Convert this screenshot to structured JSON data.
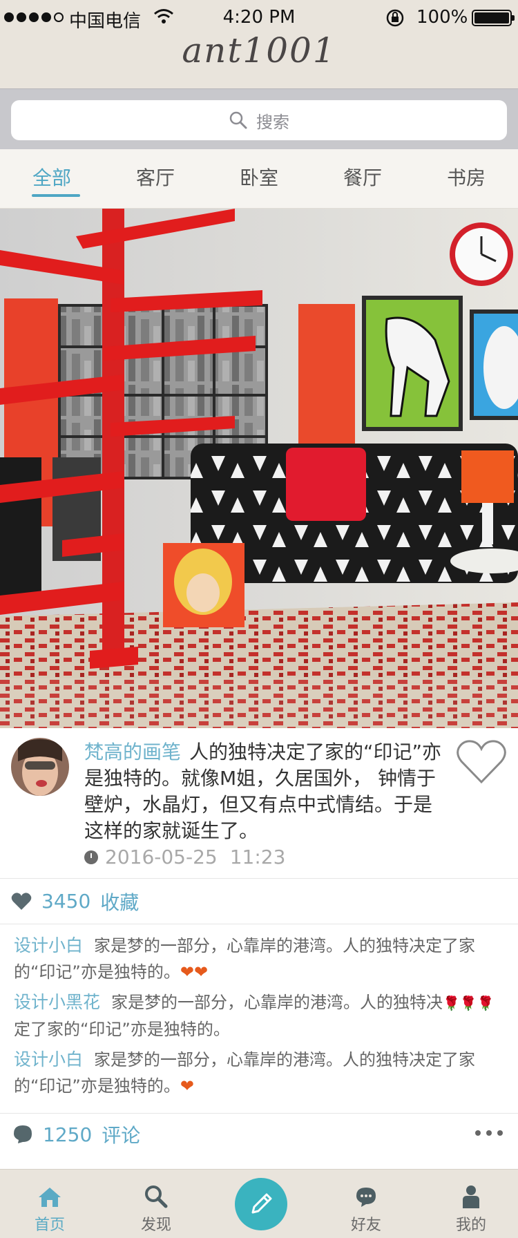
{
  "status_bar": {
    "carrier": "中国电信",
    "time": "4:20 PM",
    "battery": "100%"
  },
  "header": {
    "logo": "ant1001"
  },
  "search": {
    "placeholder": "搜索"
  },
  "tabs": [
    {
      "label": "全部",
      "active": true
    },
    {
      "label": "客厅",
      "active": false
    },
    {
      "label": "卧室",
      "active": false
    },
    {
      "label": "餐厅",
      "active": false
    },
    {
      "label": "书房",
      "active": false
    }
  ],
  "post": {
    "author": "梵高的画笔",
    "text": "人的独特决定了家的“印记”亦是独特的。就像M姐，久居国外， 钟情于壁炉，水晶灯，但又有点中式情结。于是这样的家就诞生了。",
    "date": "2016-05-25",
    "time": "11:23"
  },
  "favorites": {
    "count": "3450",
    "label": "收藏"
  },
  "comments": [
    {
      "author": "设计小白",
      "text": "家是梦的一部分，心靠岸的港湾。人的独特决定了家的“印记”亦是独特的。",
      "emoji": "❤❤"
    },
    {
      "author": "设计小黑花",
      "text": "家是梦的一部分，心靠岸的港湾。人的独特决",
      "emoji": "🌹🌹🌹",
      "text2": "定了家的“印记”亦是独特的。"
    },
    {
      "author": "设计小白",
      "text": "家是梦的一部分，心靠岸的港湾。人的独特决定了家的“印记”亦是独特的。",
      "emoji": "❤"
    }
  ],
  "comment_summary": {
    "count": "1250",
    "label": "评论"
  },
  "bottom_nav": [
    {
      "label": "首页",
      "icon": "home-icon",
      "active": true
    },
    {
      "label": "发现",
      "icon": "search-icon",
      "active": false
    },
    {
      "label": "",
      "icon": "pencil-icon",
      "active": false
    },
    {
      "label": "好友",
      "icon": "chat-icon",
      "active": false
    },
    {
      "label": "我的",
      "icon": "person-icon",
      "active": false
    }
  ],
  "colors": {
    "accent": "#4ea6c4",
    "header_bg": "#e9e4dc",
    "compose_bg": "#3ab3bf"
  }
}
